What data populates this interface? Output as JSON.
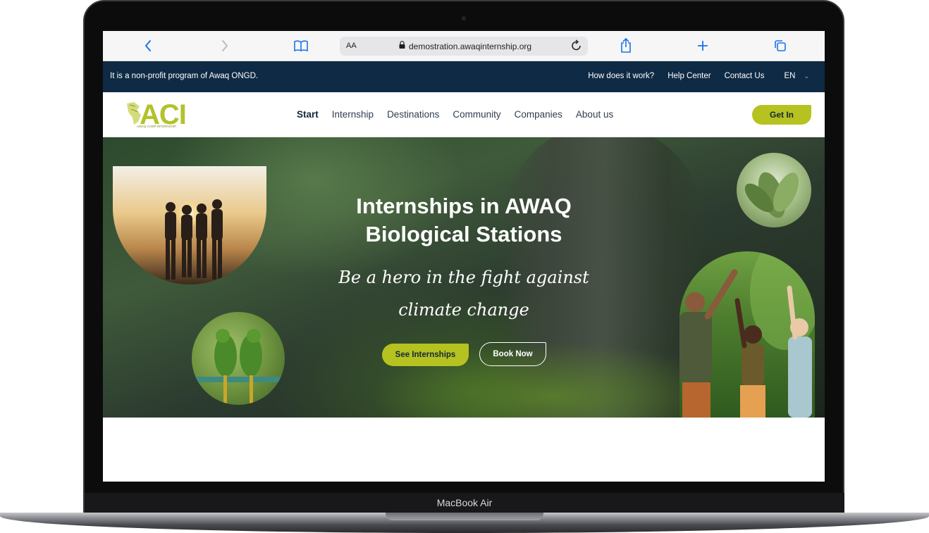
{
  "device": {
    "model_label": "MacBook Air"
  },
  "browser": {
    "aa_label": "AA",
    "url": "demostration.awaqinternship.org",
    "icons": [
      "chevron-left-icon",
      "chevron-right-icon",
      "book-icon",
      "lock-icon",
      "reload-icon",
      "share-icon",
      "plus-icon",
      "tabs-icon"
    ],
    "accent_color": "#1a73e8"
  },
  "info_bar": {
    "text": "It is a non-profit program of Awaq ONGD.",
    "links": [
      "How does it work?",
      "Help Center",
      "Contact Us"
    ],
    "language": "EN",
    "background": "#0f2a44"
  },
  "navbar": {
    "logo_text": "ACI",
    "logo_tagline": "AWAQ CAMP INTERNSHIP",
    "menu": [
      "Start",
      "Internship",
      "Destinations",
      "Community",
      "Companies",
      "About us"
    ],
    "active": "Start",
    "cta": "Get In",
    "brand_color": "#b6c21f"
  },
  "hero": {
    "title": "Internships in AWAQ Biological Stations",
    "subtitle": "Be a hero in the fight against climate change",
    "primary_button": "See Internships",
    "secondary_button": "Book Now"
  }
}
